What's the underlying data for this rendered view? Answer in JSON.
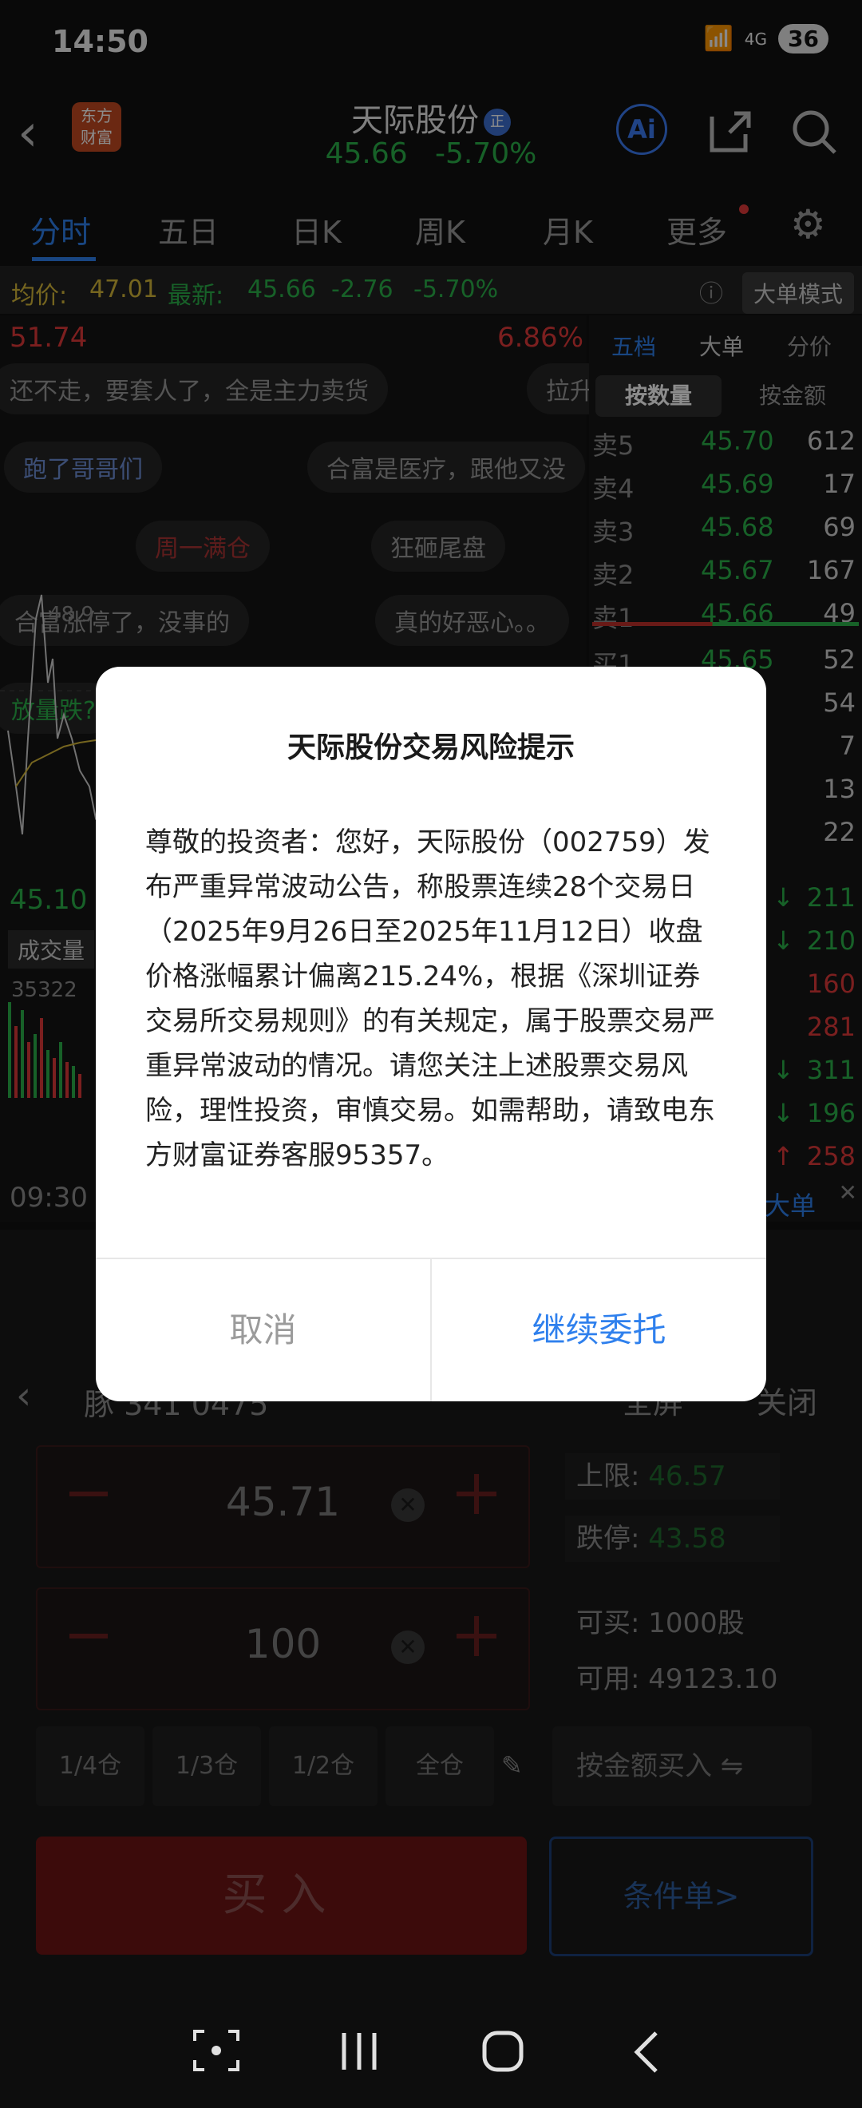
{
  "status_bar": {
    "time": "14:50",
    "network": "4G",
    "battery": "36"
  },
  "header": {
    "logo_line1": "东方",
    "logo_line2": "财富",
    "stock_name": "天际股份",
    "stock_tag": "正",
    "price": "45.66",
    "change_pct": "-5.70%",
    "ai_label": "Ai"
  },
  "tabs": [
    "分时",
    "五日",
    "日K",
    "周K",
    "月K",
    "更多"
  ],
  "price_bar": {
    "avg_label": "均价:",
    "avg_value": "47.01",
    "latest_label": "最新:",
    "latest_value": "45.66",
    "change": "-2.76",
    "change_pct": "-5.70%",
    "mode_button": "大单模式"
  },
  "chart": {
    "high_price": "51.74",
    "high_pct": "6.86%",
    "low_price": "45.10",
    "volume_label": "成交量",
    "volume_value": "35322",
    "time_start": "09:30",
    "mid_label": "48.9",
    "comments": [
      "还不走，要套人了，全是主力卖货",
      "拉升",
      "跑了哥哥们",
      "合富是医疗，跟他又没",
      "周一满仓",
      "狂砸尾盘",
      "合富涨停了，没事的",
      "真的好恶心。。",
      "放量跌?"
    ]
  },
  "order_book": {
    "tabs": [
      "五档",
      "大单",
      "分价"
    ],
    "sub_tabs": [
      "按数量",
      "按金额"
    ],
    "asks": [
      {
        "label": "卖5",
        "price": "45.70",
        "vol": "612"
      },
      {
        "label": "卖4",
        "price": "45.69",
        "vol": "17"
      },
      {
        "label": "卖3",
        "price": "45.68",
        "vol": "69"
      },
      {
        "label": "卖2",
        "price": "45.67",
        "vol": "167"
      },
      {
        "label": "卖1",
        "price": "45.66",
        "vol": "49"
      }
    ],
    "bids": [
      {
        "label": "买1",
        "price": "45.65",
        "vol": "52"
      },
      {
        "label": "",
        "price": "",
        "vol": "54"
      },
      {
        "label": "",
        "price": "",
        "vol": "7"
      },
      {
        "label": "",
        "price": "",
        "vol": "13"
      },
      {
        "label": "",
        "price": "",
        "vol": "22"
      }
    ],
    "ticks": [
      {
        "dir": "↓",
        "vol": "211"
      },
      {
        "dir": "↓",
        "vol": "210"
      },
      {
        "dir": "",
        "vol": "160"
      },
      {
        "dir": "",
        "vol": "281"
      },
      {
        "dir": "↓",
        "vol": "311"
      },
      {
        "dir": "↓",
        "vol": "196"
      },
      {
        "dir": "↑",
        "vol": "258"
      }
    ],
    "big_order_label": "大单"
  },
  "trade": {
    "fullscreen_label": "全屏",
    "close_label": "关闭",
    "nav_text": "豚  341      0475",
    "price_input": "45.71",
    "qty_input": "100",
    "upper_limit_label": "上限:",
    "upper_limit": "46.57",
    "lower_limit_label": "跌停:",
    "lower_limit": "43.58",
    "can_buy_label": "可买:",
    "can_buy": "1000股",
    "available_label": "可用:",
    "available": "49123.10",
    "positions": [
      "1/4仓",
      "1/3仓",
      "1/2仓",
      "全仓"
    ],
    "amount_buy": "按金额买入 ⇋",
    "buy_button": "买入",
    "condition_button": "条件单>"
  },
  "dialog": {
    "title": "天际股份交易风险提示",
    "body": "尊敬的投资者：您好，天际股份（002759）发布严重异常波动公告，称股票连续28个交易日（2025年9月26日至2025年11月12日）收盘价格涨幅累计偏离215.24%，根据《深圳证券交易所交易规则》的有关规定，属于股票交易严重异常波动的情况。请您关注上述股票交易风险，理性投资，审慎交易。如需帮助，请致电东方财富证券客服95357。",
    "cancel": "取消",
    "confirm": "继续委托"
  }
}
